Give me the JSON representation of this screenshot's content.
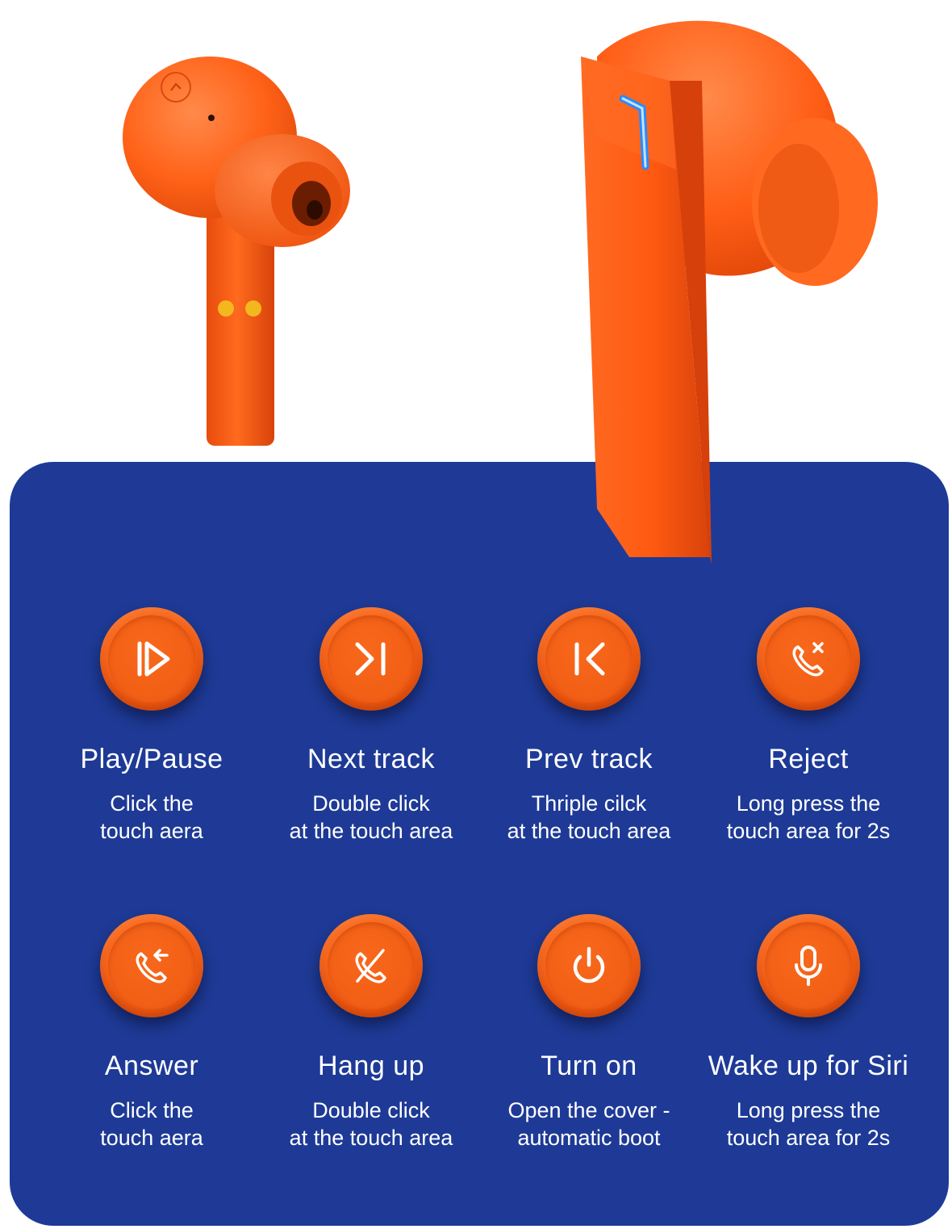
{
  "colors": {
    "panel": "#1e3a96",
    "button": "#f45d14",
    "earbud": "#ff5c12",
    "text": "#ffffff"
  },
  "controls": [
    {
      "icon": "play-pause-icon",
      "title": "Play/Pause",
      "desc": "Click the\ntouch aera"
    },
    {
      "icon": "next-track-icon",
      "title": "Next track",
      "desc": "Double click\nat the touch area"
    },
    {
      "icon": "prev-track-icon",
      "title": "Prev track",
      "desc": "Thriple cilck\nat the touch area"
    },
    {
      "icon": "reject-call-icon",
      "title": "Reject",
      "desc": "Long press the\ntouch area for 2s"
    },
    {
      "icon": "answer-call-icon",
      "title": "Answer",
      "desc": "Click the\ntouch aera"
    },
    {
      "icon": "hang-up-icon",
      "title": "Hang up",
      "desc": "Double click\nat the touch area"
    },
    {
      "icon": "power-icon",
      "title": "Turn on",
      "desc": "Open the cover -\nautomatic boot"
    },
    {
      "icon": "microphone-icon",
      "title": "Wake up for Siri",
      "desc": "Long press the\ntouch area for 2s"
    }
  ]
}
